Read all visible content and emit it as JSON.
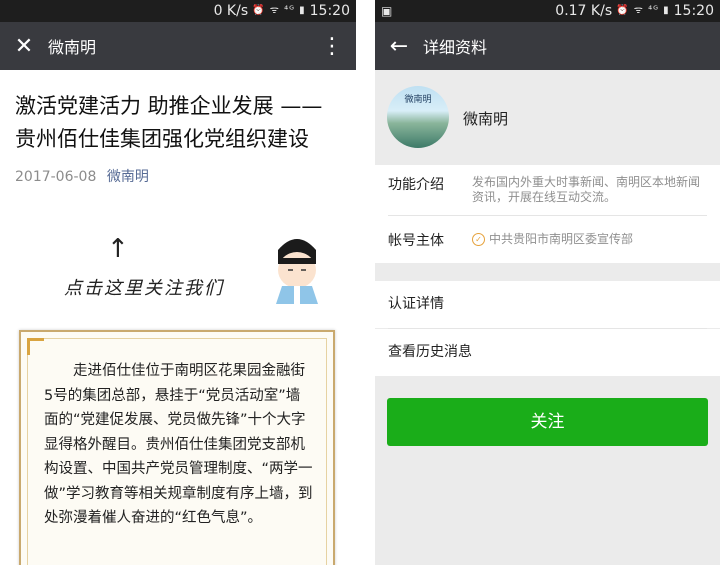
{
  "left": {
    "status": {
      "net": "0 K/s",
      "time": "15:20"
    },
    "topbar": {
      "title": "微南明"
    },
    "article": {
      "title": "激活党建活力 助推企业发展 ——贵州佰仕佳集团强化党组织建设",
      "date": "2017-06-08",
      "account": "微南明",
      "banner_text": "点击这里关注我们",
      "body": "走进佰仕佳位于南明区花果园金融街5号的集团总部，悬挂于“党员活动室”墙面的“党建促发展、党员做先锋”十个大字显得格外醒目。贵州佰仕佳集团党支部机构设置、中国共产党员管理制度、“两学一做”学习教育等相关规章制度有序上墙，到处弥漫着催人奋进的“红色气息”。"
    }
  },
  "right": {
    "status": {
      "net": "0.17 K/s",
      "time": "15:20"
    },
    "topbar": {
      "title": "详细资料"
    },
    "profile": {
      "name": "微南明",
      "avatar_text": "微南明"
    },
    "intro": {
      "label": "功能介绍",
      "value": "发布国内外重大时事新闻、南明区本地新闻资讯，开展在线互动交流。"
    },
    "owner": {
      "label": "帐号主体",
      "value": "中共贵阳市南明区委宣传部"
    },
    "links": {
      "certification": "认证详情",
      "history": "查看历史消息"
    },
    "follow_button": "关注"
  },
  "colors": {
    "topbar": "#393a3f",
    "accent_green": "#1aad19",
    "link_blue": "#576b95"
  }
}
